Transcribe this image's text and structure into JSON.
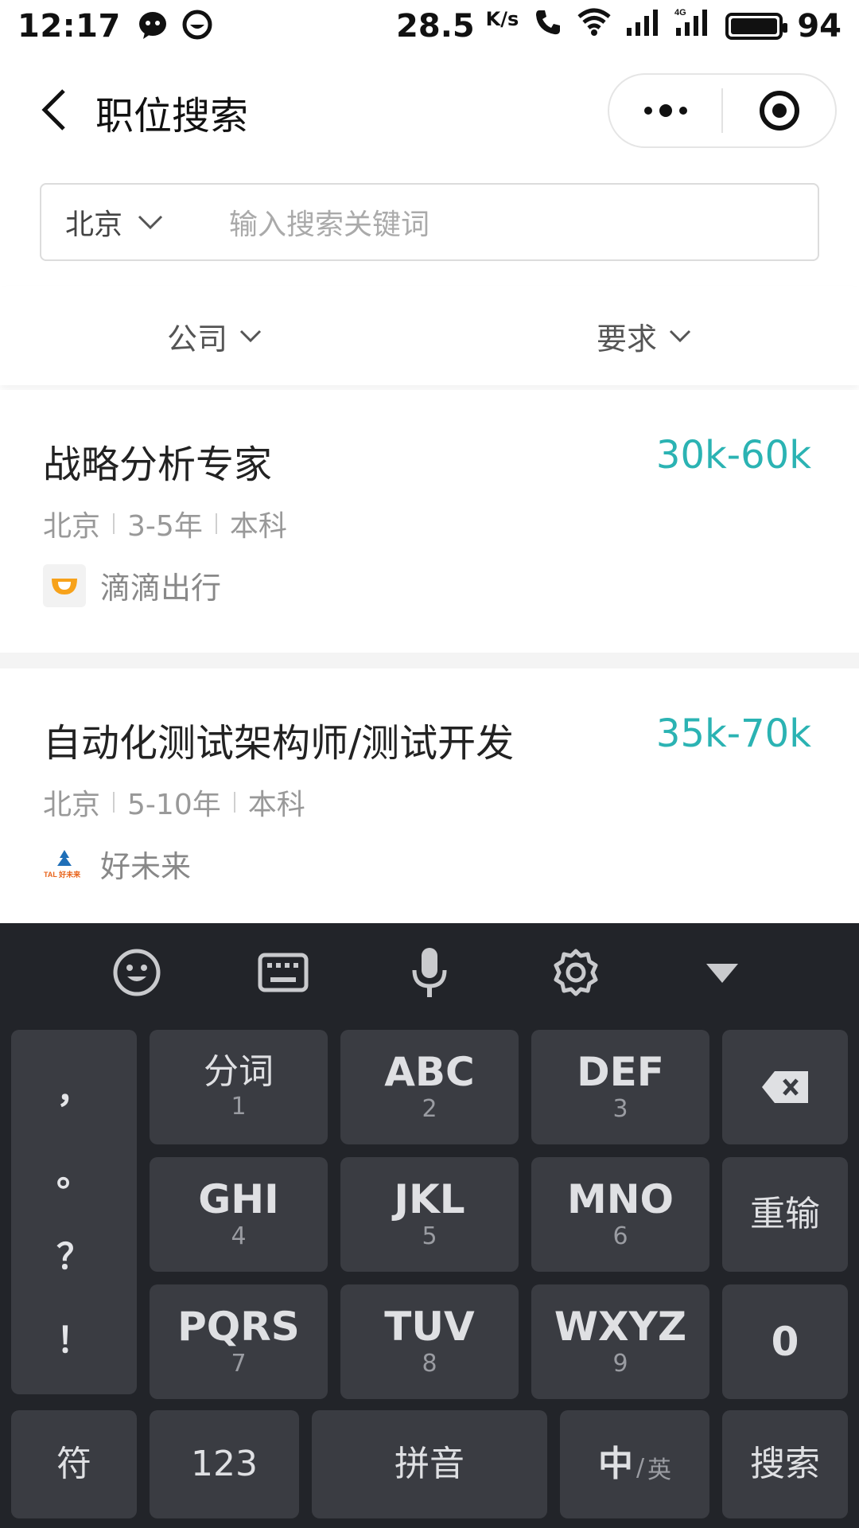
{
  "status_bar": {
    "time": "12:17",
    "speed_value": "28.5",
    "speed_unit": "K/s",
    "network": "4G",
    "battery": "94"
  },
  "nav": {
    "title": "职位搜索"
  },
  "search": {
    "city": "北京",
    "placeholder": "输入搜索关键词"
  },
  "filters": [
    {
      "label": "公司"
    },
    {
      "label": "要求"
    }
  ],
  "jobs": [
    {
      "title": "战略分析专家",
      "salary": "30k-60k",
      "city": "北京",
      "experience": "3-5年",
      "education": "本科",
      "company": "滴滴出行"
    },
    {
      "title": "自动化测试架构师/测试开发",
      "salary": "35k-70k",
      "city": "北京",
      "experience": "5-10年",
      "education": "本科",
      "company": "好未来",
      "company_logo_text": "TAL 好未来"
    }
  ],
  "keyboard": {
    "toolbar": [
      "emoji-icon",
      "keyboard-icon",
      "microphone-icon",
      "settings-icon",
      "hide-keyboard-icon"
    ],
    "punctuation": [
      "，",
      "。",
      "？",
      "！"
    ],
    "keys": [
      {
        "main": "分词",
        "sub": "1"
      },
      {
        "main": "ABC",
        "sub": "2"
      },
      {
        "main": "DEF",
        "sub": "3"
      },
      {
        "main": "GHI",
        "sub": "4"
      },
      {
        "main": "JKL",
        "sub": "5"
      },
      {
        "main": "MNO",
        "sub": "6"
      },
      {
        "main": "PQRS",
        "sub": "7"
      },
      {
        "main": "TUV",
        "sub": "8"
      },
      {
        "main": "WXYZ",
        "sub": "9"
      }
    ],
    "reinput": "重输",
    "zero": "0",
    "symbols": "符",
    "numbers": "123",
    "pinyin": "拼音",
    "lang_cn": "中",
    "lang_sep": "/",
    "lang_en": "英",
    "search": "搜索"
  },
  "colors": {
    "salary": "#2bb3b3",
    "keyboard_bg": "#222429",
    "key_bg": "#3a3c42"
  }
}
